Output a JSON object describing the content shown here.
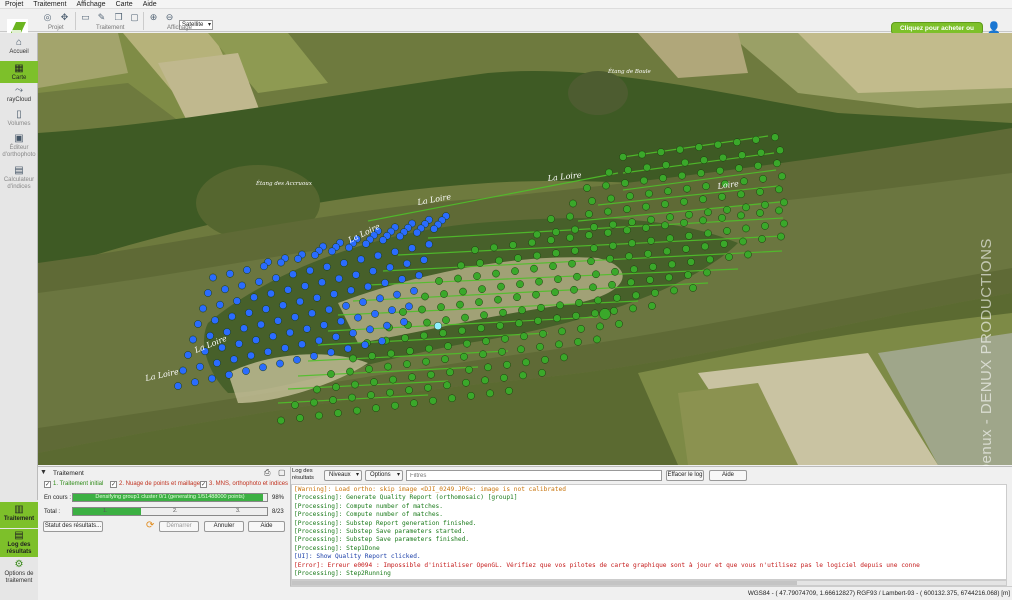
{
  "menu": [
    "Projet",
    "Traitement",
    "Affichage",
    "Carte",
    "Aide"
  ],
  "toolbar": {
    "group_projet": "Projet",
    "group_traitement": "Traitement",
    "group_affichage": "Affichage",
    "basemap": "Satellite",
    "buy_label": "Cliquez pour acheter ou louer"
  },
  "sidebar": {
    "items": [
      "Accueil",
      "Carte",
      "rayCloud",
      "Volumes",
      "Éditeur d'orthophoto",
      "Calculateur d'indices"
    ],
    "bottom": [
      "Traitement",
      "Log des résultats",
      "Options de traitement"
    ]
  },
  "map": {
    "labels": [
      "La Loire",
      "La Loire",
      "La Loire",
      "Loire",
      "La Loire",
      "La Loire",
      "Étang de Boule",
      "Étang des Accruoux"
    ],
    "watermark": "Copyright Oliver Denux - DENUX PRODUCTIONS"
  },
  "processing": {
    "title": "Traitement",
    "step1": "1. Traitement initial",
    "step2": "2. Nuage de points et maillage",
    "step3": "3. MNS, orthophoto et indices",
    "current_label": "En cours :",
    "current_text": "Densifying group1 cluster 0/1 (generating 1/51488000 points)",
    "current_pct": "98%",
    "current_progress": 0.98,
    "total_label": "Total :",
    "total_steps": [
      "1.",
      "2.",
      "3."
    ],
    "total_count": "8/23",
    "total_progress": 0.35,
    "btn_status": "Statut des résultats...",
    "btn_start": "Démarrer",
    "btn_cancel": "Annuler",
    "btn_help": "Aide"
  },
  "log": {
    "title": "Log des résultats",
    "levels": "Niveaux",
    "options": "Options",
    "filter_placeholder": "Filtres",
    "clear": "Effacer le log",
    "help": "Aide",
    "lines": [
      {
        "t": "warn",
        "text": "[Warning]: Load ortho: skip image <DJI_0249.JPG>: image is not calibrated"
      },
      {
        "t": "proc",
        "text": "[Processing]: Generate Quality Report (orthomosaic) [group1]"
      },
      {
        "t": "proc",
        "text": "[Processing]: Compute number of matches."
      },
      {
        "t": "proc",
        "text": "[Processing]: Compute number of matches."
      },
      {
        "t": "proc",
        "text": "[Processing]: Substep Report generation finished."
      },
      {
        "t": "proc",
        "text": "[Processing]: Substep Save parameters started."
      },
      {
        "t": "proc",
        "text": "[Processing]: Substep Save parameters finished."
      },
      {
        "t": "proc",
        "text": "[Processing]: Step1Done"
      },
      {
        "t": "ui",
        "text": "[UI]: Show Quality Report clicked."
      },
      {
        "t": "err",
        "text": "[Error]: Erreur e0094 : Impossible d'initialiser OpenGL. Vérifiez que vos pilotes de carte graphique sont à jour et que vous n'utilisez pas le logiciel depuis une conne"
      },
      {
        "t": "proc",
        "text": "[Processing]: Step2Running"
      }
    ]
  },
  "status": "WGS84 - ( 47.79074709,   1.66612827)  RGF93 / Lambert-93 - (   600132.375,   6744216.068)  [m]",
  "colors": {
    "accent": "#7dc02a",
    "calibrated_point": "#3aa82a",
    "uncalibrated_point": "#2a6cff"
  }
}
